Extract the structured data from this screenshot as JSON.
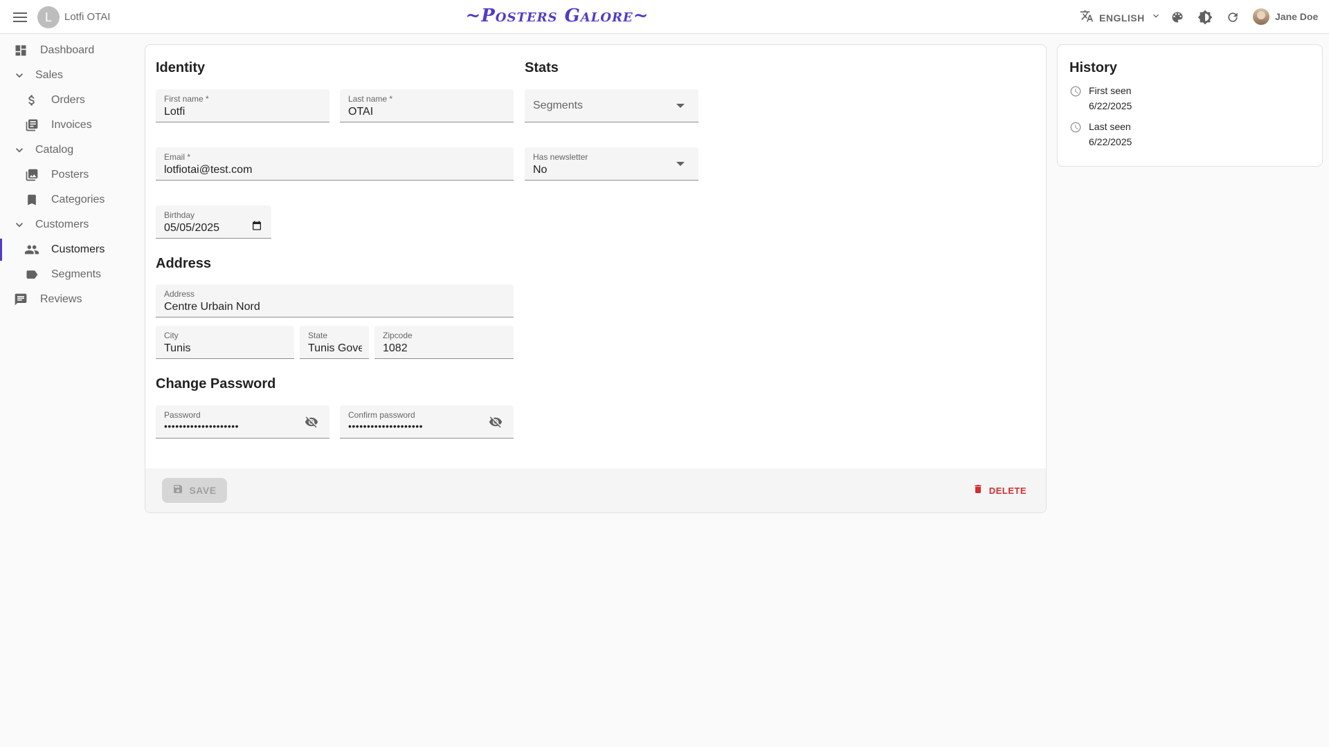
{
  "app": {
    "record_initial": "L",
    "record_title": "Lotfi OTAI",
    "brand": "~Posters Galore~",
    "language": "ENGLISH",
    "user_name": "Jane Doe",
    "accent_color": "#4f3cc9"
  },
  "sidebar": {
    "dashboard": "Dashboard",
    "sales": "Sales",
    "orders": "Orders",
    "invoices": "Invoices",
    "catalog": "Catalog",
    "posters": "Posters",
    "categories": "Categories",
    "customers_group": "Customers",
    "customers": "Customers",
    "segments": "Segments",
    "reviews": "Reviews"
  },
  "form": {
    "identity_title": "Identity",
    "stats_title": "Stats",
    "address_title": "Address",
    "password_title": "Change Password",
    "first_name_label": "First name *",
    "first_name": "Lotfi",
    "last_name_label": "Last name *",
    "last_name": "OTAI",
    "email_label": "Email *",
    "email": "lotfiotai@test.com",
    "birthday_label": "Birthday",
    "birthday": "05/05/2025",
    "segments_placeholder": "Segments",
    "newsletter_label": "Has newsletter",
    "newsletter": "No",
    "address_label": "Address",
    "address": "Centre Urbain Nord",
    "city_label": "City",
    "city": "Tunis",
    "state_label": "State",
    "state": "Tunis Gove",
    "zipcode_label": "Zipcode",
    "zipcode": "1082",
    "password_label": "Password",
    "password_mask": "••••••••••••••••••••",
    "confirm_label": "Confirm password",
    "confirm_mask": "••••••••••••••••••••",
    "save_label": "SAVE",
    "delete_label": "DELETE",
    "delete_color": "#d32f2f"
  },
  "history": {
    "title": "History",
    "first_seen_label": "First seen",
    "first_seen": "6/22/2025",
    "last_seen_label": "Last seen",
    "last_seen": "6/22/2025"
  }
}
